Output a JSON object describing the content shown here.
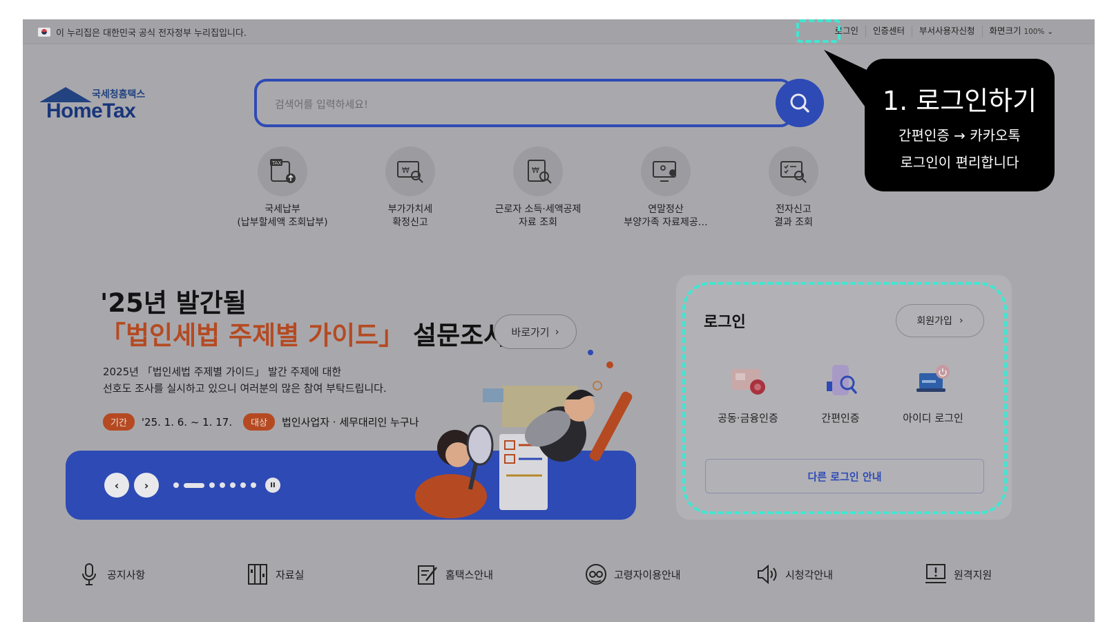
{
  "gov_bar": {
    "notice": "이 누리집은 대한민국 공식 전자정부 누리집입니다.",
    "links": [
      "로그인",
      "인증센터",
      "부서사용자신청"
    ],
    "zoom_label": "화면크기",
    "zoom_value": "100%"
  },
  "logo": {
    "small": "국세청홈택스",
    "big": "HomeTax"
  },
  "search": {
    "placeholder": "검색어를 입력하세요!"
  },
  "quick_menu": [
    {
      "line1": "국세납부",
      "line2": "(납부할세액 조회납부)",
      "icon": "tax-payment-icon"
    },
    {
      "line1": "부가가치세",
      "line2": "확정신고",
      "icon": "vat-report-icon"
    },
    {
      "line1": "근로자 소득·세액공제",
      "line2": "자료 조회",
      "icon": "deduction-data-icon"
    },
    {
      "line1": "연말정산",
      "line2": "부양가족 자료제공…",
      "icon": "year-end-settlement-icon"
    },
    {
      "line1": "전자신고",
      "line2": "결과 조회",
      "icon": "e-filing-result-icon"
    }
  ],
  "callout": {
    "title": "1. 로그인하기",
    "line1": "간편인증 → 카카오톡",
    "line2": "로그인이 편리합니다"
  },
  "banner": {
    "title1": "'25년 발간될",
    "title2_orange": "「법인세법 주제별 가이드」",
    "title2_black": " 설문조사",
    "go_label": "바로가기",
    "desc1": "2025년 「법인세법 주제별 가이드」 발간 주제에 대한",
    "desc2": "선호도 조사를 실시하고 있으니 여러분의 많은 참여 부탁드립니다.",
    "period_tag": "기간",
    "period": "'25. 1. 6. ~ 1. 17.",
    "target_tag": "대상",
    "target": "법인사업자 · 세무대리인 누구나"
  },
  "login": {
    "title": "로그인",
    "join_label": "회원가입",
    "methods": [
      "공동·금융인증",
      "간편인증",
      "아이디 로그인"
    ],
    "other_label": "다른 로그인 안내"
  },
  "bottom_nav": [
    "공지사항",
    "자료실",
    "홈택스안내",
    "고령자이용안내",
    "시청각안내",
    "원격지원"
  ],
  "colors": {
    "accent": "#2e4ab5",
    "highlight": "#3ee8d2",
    "orange": "#b54a22"
  }
}
